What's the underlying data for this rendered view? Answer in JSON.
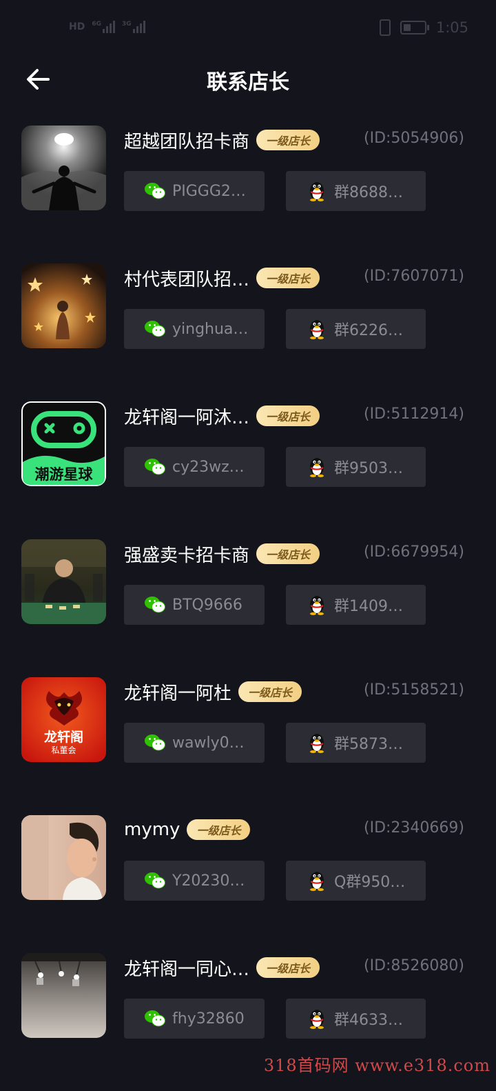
{
  "status_bar": {
    "network_left": "HD",
    "network_6g": "6G",
    "network_3g": "3G",
    "time": "1:05"
  },
  "header": {
    "title": "联系店长"
  },
  "shops": [
    {
      "name": "超越团队招卡商",
      "level": "一级店长",
      "id": "(ID:5054906)",
      "wechat": "PIGGG2…",
      "qq": "群8688…"
    },
    {
      "name": "村代表团队招…",
      "level": "一级店长",
      "id": "(ID:7607071)",
      "wechat": "yinghua…",
      "qq": "群6226…"
    },
    {
      "name": "龙轩阁一阿沐…",
      "level": "一级店长",
      "id": "(ID:5112914)",
      "wechat": "cy23wz…",
      "qq": "群9503…",
      "avatar_text": "潮游星球"
    },
    {
      "name": "强盛卖卡招卡商",
      "level": "一级店长",
      "id": "(ID:6679954)",
      "wechat": "BTQ9666",
      "qq": "群1409…"
    },
    {
      "name": "龙轩阁一阿杜",
      "level": "一级店长",
      "id": "(ID:5158521)",
      "wechat": "wawly0…",
      "qq": "群5873…",
      "avatar_text": "龙轩阁",
      "avatar_subtext": "私董会"
    },
    {
      "name": "mymy",
      "level": "一级店长",
      "id": "(ID:2340669)",
      "wechat": "Y20230…",
      "qq": "Q群950…"
    },
    {
      "name": "龙轩阁一同心…",
      "level": "一级店长",
      "id": "(ID:8526080)",
      "wechat": "fhy32860",
      "qq": "群4633…"
    }
  ],
  "icons": {
    "back": "arrow-left-icon",
    "wechat": "wechat-icon",
    "qq": "qq-penguin-icon"
  },
  "colors": {
    "background": "#14151c",
    "card": "#2c2d34",
    "badge_start": "#fbe7b4",
    "badge_end": "#f2cf83",
    "wechat_green": "#2dc100",
    "watermark": "#e34f4f"
  },
  "watermark": "318首码网  www.e318.com"
}
